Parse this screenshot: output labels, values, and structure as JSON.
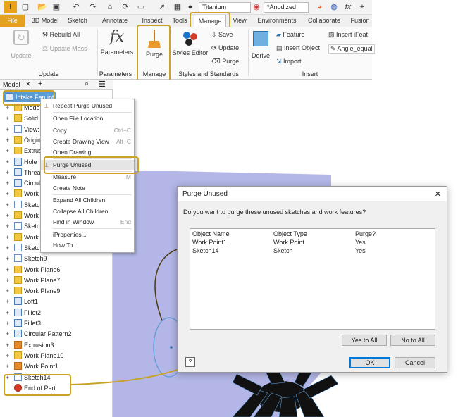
{
  "qat": {
    "doc_name": "Titanium",
    "appearance": "*Anodized",
    "fx": "fx"
  },
  "tabs": [
    "File",
    "3D Model",
    "Sketch",
    "Annotate",
    "Inspect",
    "Tools",
    "Manage",
    "View",
    "Environments",
    "Collaborate",
    "Fusion"
  ],
  "ribbon": {
    "update": {
      "update": "Update",
      "rebuild_all": "Rebuild All",
      "update_mass": "Update Mass",
      "group": "Update"
    },
    "parameters": {
      "label": "Parameters",
      "group": "Parameters",
      "arrow": "▾"
    },
    "manage": {
      "purge": "Purge",
      "group": "Manage"
    },
    "styles": {
      "editor": "Styles Editor",
      "save": "Save",
      "update": "Update",
      "purge": "Purge",
      "group": "Styles and Standards"
    },
    "insert": {
      "derive": "Derive",
      "feature": "Feature",
      "insert_object": "Insert Object",
      "import": "Import",
      "insert_ifeat": "Insert iFeat",
      "angle_equal": "Angle_equal",
      "group": "Insert"
    }
  },
  "browser": {
    "tab": "Model",
    "root": "Intake Fan.ipt",
    "nodes": [
      "Model",
      "Solid B",
      "View:",
      "Origin",
      "Extrus",
      "Hole",
      "Thread",
      "Circular",
      "Work P",
      "Sketch",
      "Work P",
      "Sketch",
      "Work P",
      "Sketch8",
      "Sketch9",
      "Work Plane6",
      "Work Plane7",
      "Work Plane9",
      "Loft1",
      "Fillet2",
      "Fillet3",
      "Circular Pattern2",
      "Extrusion3",
      "Work Plane10",
      "Work Point1",
      "Sketch14",
      "End of Part"
    ]
  },
  "context_menu": [
    {
      "label": "Repeat Purge Unused",
      "shortcut": ""
    },
    {
      "label": "Open File Location",
      "shortcut": ""
    },
    {
      "label": "Copy",
      "shortcut": "Ctrl+C"
    },
    {
      "label": "Create Drawing View",
      "shortcut": "Alt+C"
    },
    {
      "label": "Open Drawing",
      "shortcut": ""
    },
    {
      "label": "Purge Unused",
      "shortcut": ""
    },
    {
      "label": "Measure",
      "shortcut": "M"
    },
    {
      "label": "Create Note",
      "shortcut": ""
    },
    {
      "label": "Expand All Children",
      "shortcut": ""
    },
    {
      "label": "Collapse All Children",
      "shortcut": ""
    },
    {
      "label": "Find in Window",
      "shortcut": "End"
    },
    {
      "label": "iProperties...",
      "shortcut": ""
    },
    {
      "label": "How To...",
      "shortcut": ""
    }
  ],
  "dialog": {
    "title": "Purge Unused",
    "close": "✕",
    "question": "Do you want to purge these unused sketches and work features?",
    "columns": [
      "Object Name",
      "Object Type",
      "Purge?"
    ],
    "rows": [
      [
        "Work Point1",
        "Work Point",
        "Yes"
      ],
      [
        "Sketch14",
        "Sketch",
        "Yes"
      ]
    ],
    "yes_to_all": "Yes to All",
    "no_to_all": "No to All",
    "ok": "OK",
    "cancel": "Cancel",
    "help": "?"
  },
  "colors": {
    "file_tab": "#e2a11e",
    "highlight": "#c9a227",
    "plane": "#b3b6e6",
    "selection": "#5b9bd5"
  }
}
